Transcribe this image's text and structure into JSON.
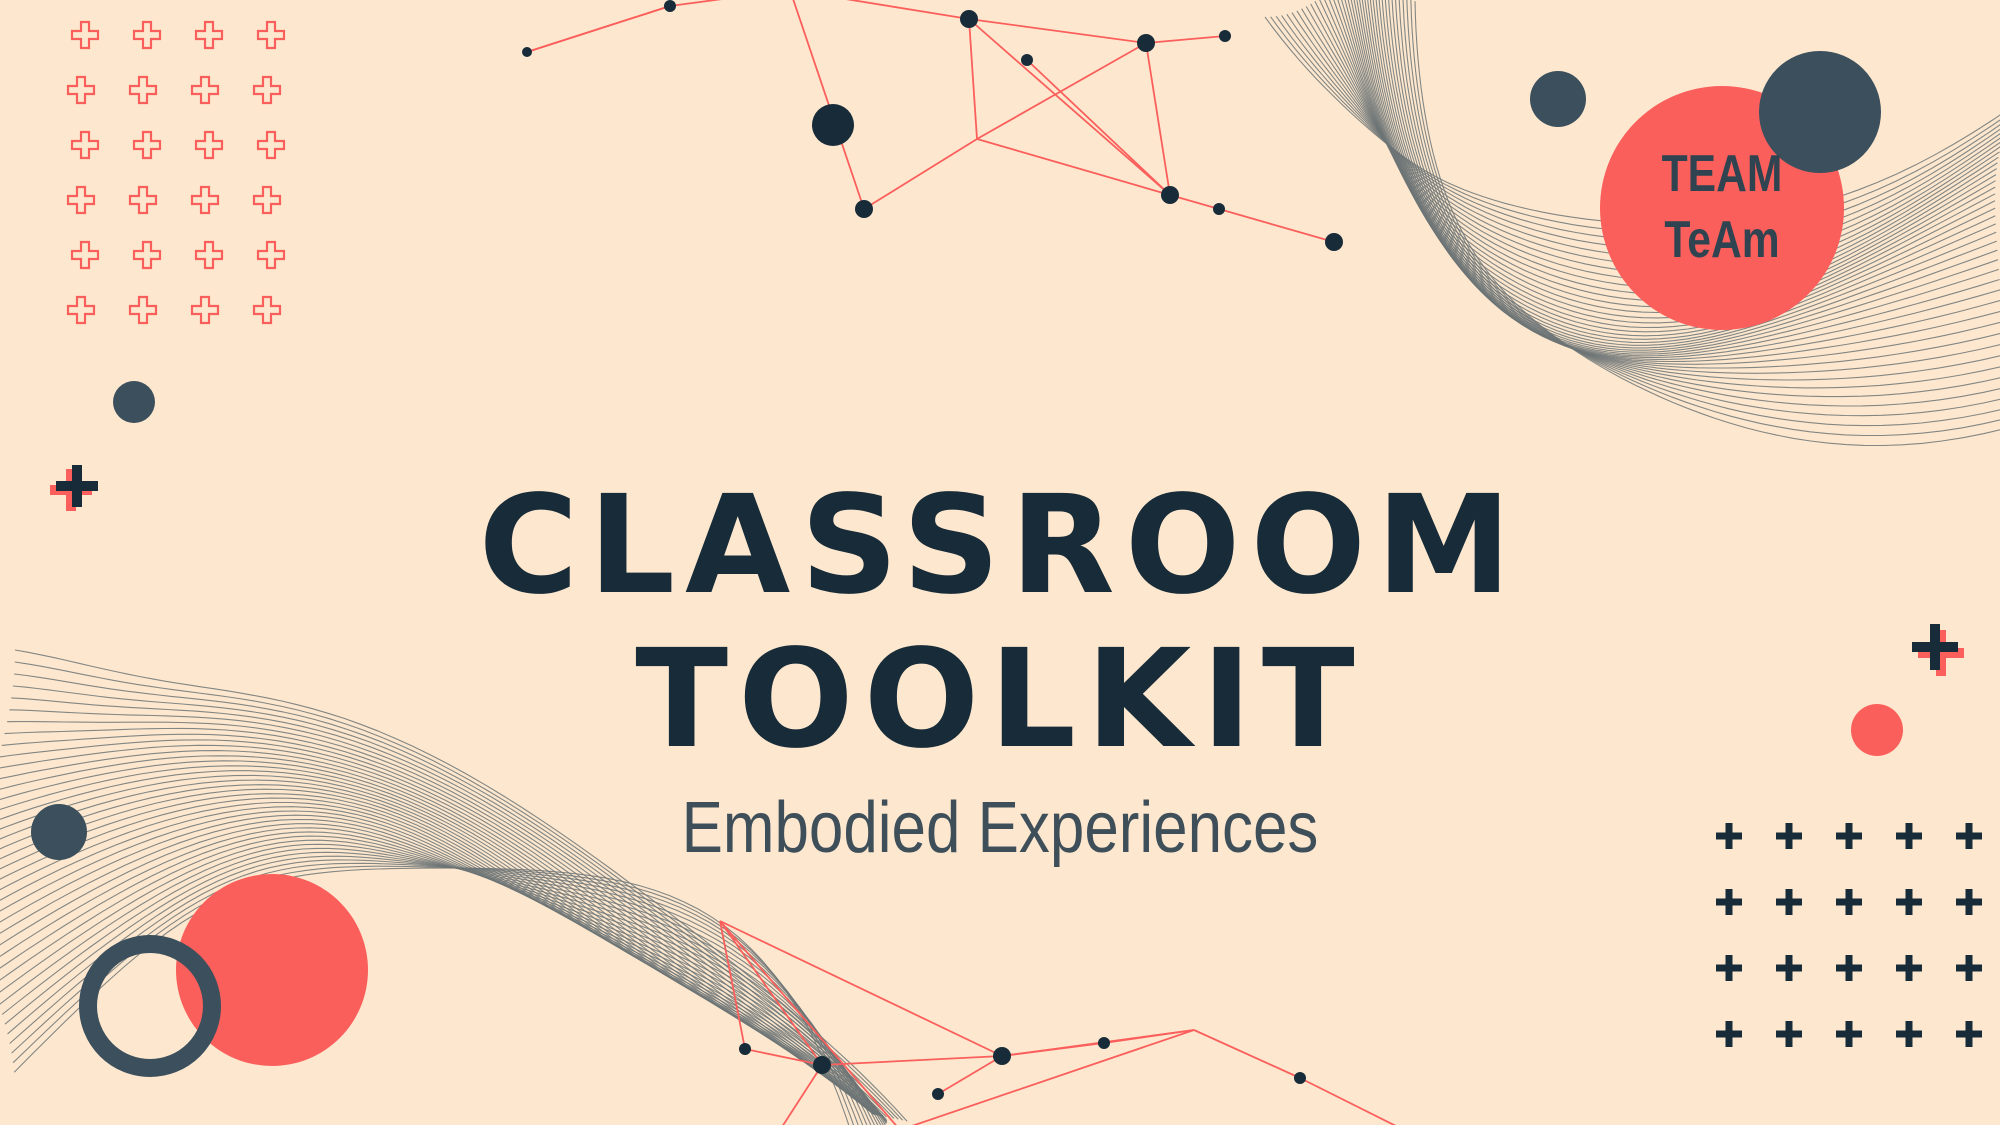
{
  "slide": {
    "title_line1": "CLASSROOM",
    "title_line2": "TOOLKIT",
    "subtitle": "Embodied Experiences",
    "badge_line1": "TEAM",
    "badge_line2": "TeAm"
  },
  "colors": {
    "background": "#fde8cf",
    "navy": "#172b38",
    "slate": "#3b4f5c",
    "coral": "#fb5f5c",
    "wave_line": "#6d7476"
  },
  "icons": [
    "plus-icon",
    "dot-icon",
    "ring-icon",
    "network-graph",
    "wave-lines"
  ]
}
